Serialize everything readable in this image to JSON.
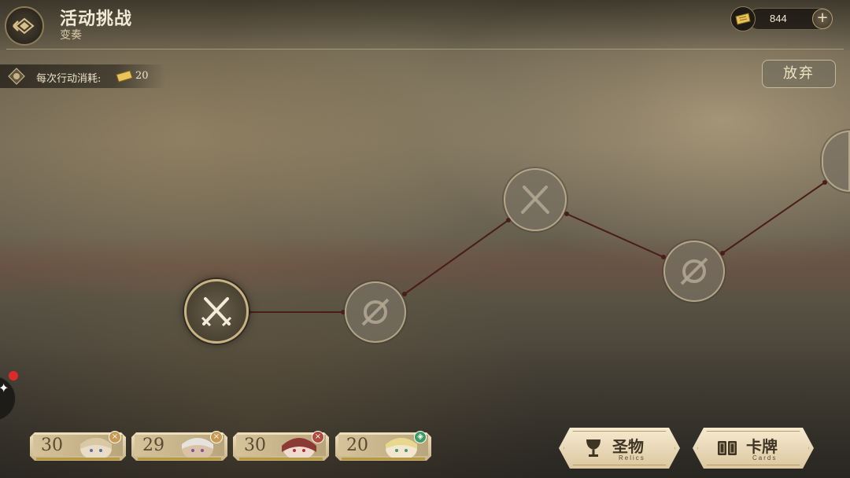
{
  "header": {
    "title": "活动挑战",
    "subtitle": "变奏"
  },
  "currency": {
    "value": "844",
    "icon": "ticket-icon"
  },
  "cost": {
    "label": "每次行动消耗:",
    "value": "20"
  },
  "abandon_label": "放弃",
  "nodes": [
    {
      "state": "active",
      "icon": "crossed-swords-icon"
    },
    {
      "state": "locked",
      "icon": "locked-battle-icon"
    },
    {
      "state": "locked",
      "icon": "locked-swords-icon"
    },
    {
      "state": "locked",
      "icon": "locked-battle-icon"
    },
    {
      "state": "locked",
      "icon": "locked-swords-icon"
    }
  ],
  "characters": [
    {
      "level": "30",
      "badge": "×",
      "badge_color": "#c89a52"
    },
    {
      "level": "29",
      "badge": "×",
      "badge_color": "#c89a52"
    },
    {
      "level": "30",
      "badge": "×",
      "badge_color": "#b04a3a"
    },
    {
      "level": "20",
      "badge": "◈",
      "badge_color": "#3f9a63"
    }
  ],
  "buttons": {
    "relics": {
      "label": "圣物",
      "sub": "Relics"
    },
    "cards": {
      "label": "卡牌",
      "sub": "Cards"
    }
  }
}
